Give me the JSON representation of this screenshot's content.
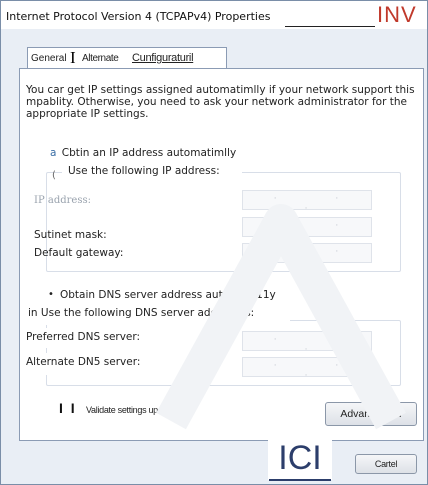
{
  "window": {
    "title": "Internet Protocol Version 4 (TCPAPv4) Properties",
    "title_mark": "INV"
  },
  "tabs": {
    "general": "General",
    "cursor": "I",
    "alternate": "Alternate",
    "configuration": "Cunfiguraturil"
  },
  "intro_text": "You car get IP settings assigned automatimlly if your network support this mpablity. Otherwise, you need to ask your network administrator for the appropriate IP settings.",
  "ip": {
    "auto_radio_glyph": "a",
    "auto_label": "Cbtin an IP address automatimlly",
    "paren": "(",
    "use_following_label": "Use the following IP address:",
    "address_label": "IP address:",
    "subnet_label": "Sutinet mask:",
    "gateway_label": "Default gateway:",
    "field_dots": "· · ·"
  },
  "dns": {
    "auto_bullet": "•",
    "auto_label": "Obtain DNS server address automati.11y",
    "use_following_label": "in Use the following DNS server addresses:",
    "preferred_label": "Preferred DNS server:",
    "alternate_label": "Alternate DN5 server:",
    "field_dots": "· · ·"
  },
  "validate": {
    "checkbox_glyph": "I I",
    "label": "Validate settings upon exit"
  },
  "buttons": {
    "advanced": "Advanced... I",
    "ok_fragment": "ICI",
    "cancel": "Cartel"
  },
  "colors": {
    "title_mark": "#c0392b",
    "ok_fragment": "#2c3e6b",
    "window_bg": "#e9eef5"
  }
}
